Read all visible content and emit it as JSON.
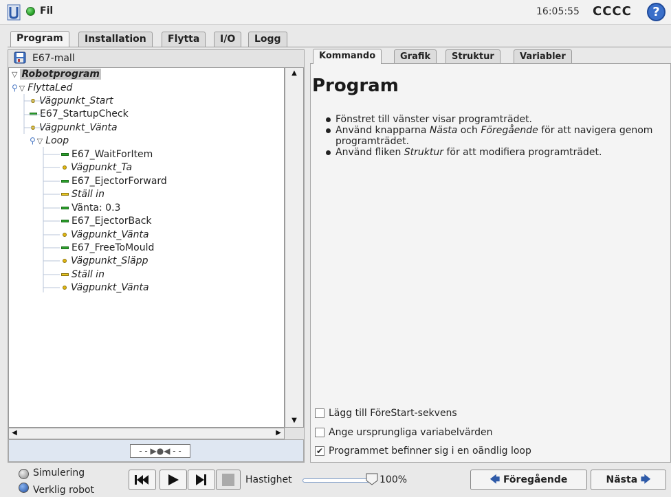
{
  "header": {
    "file_label": "Fil",
    "clock": "16:05:55",
    "robot_name": "CCCC",
    "help_glyph": "?"
  },
  "top_tabs": [
    {
      "label": "Program",
      "active": true
    },
    {
      "label": "Installation",
      "active": false
    },
    {
      "label": "Flytta",
      "active": false
    },
    {
      "label": "I/O",
      "active": false
    },
    {
      "label": "Logg",
      "active": false
    }
  ],
  "left": {
    "file_name": "E67-mall",
    "tree": [
      {
        "label": "Robotprogram",
        "type": "root",
        "style": "bold-italic-selected"
      },
      {
        "label": "FlyttaLed",
        "type": "folder",
        "style": "italic"
      },
      {
        "label": "Vägpunkt_Start",
        "type": "waypoint",
        "style": "italic"
      },
      {
        "label": "E67_StartupCheck",
        "type": "call",
        "style": "normal"
      },
      {
        "label": "Vägpunkt_Vänta",
        "type": "waypoint",
        "style": "italic"
      },
      {
        "label": "Loop",
        "type": "folder",
        "style": "italic"
      },
      {
        "label": "E67_WaitForItem",
        "type": "call",
        "style": "normal"
      },
      {
        "label": "Vägpunkt_Ta",
        "type": "waypoint",
        "style": "italic"
      },
      {
        "label": "E67_EjectorForward",
        "type": "call",
        "style": "normal"
      },
      {
        "label": "Ställ in",
        "type": "set",
        "style": "italic"
      },
      {
        "label": "Vänta: 0.3",
        "type": "call",
        "style": "normal"
      },
      {
        "label": "E67_EjectorBack",
        "type": "call",
        "style": "normal"
      },
      {
        "label": "Vägpunkt_Vänta",
        "type": "waypoint",
        "style": "italic"
      },
      {
        "label": "E67_FreeToMould",
        "type": "call",
        "style": "normal"
      },
      {
        "label": "Vägpunkt_Släpp",
        "type": "waypoint",
        "style": "italic"
      },
      {
        "label": "Ställ in",
        "type": "set",
        "style": "italic"
      },
      {
        "label": "Vägpunkt_Vänta",
        "type": "waypoint",
        "style": "italic"
      }
    ]
  },
  "right": {
    "tabs": [
      {
        "label": "Kommando",
        "active": true
      },
      {
        "label": "Grafik",
        "active": false
      },
      {
        "label": "Struktur",
        "active": false
      },
      {
        "label": "Variabler",
        "active": false
      }
    ],
    "title": "Program",
    "bullet1": "Fönstret till vänster visar programträdet.",
    "bullet2_pre": "Använd knapparna ",
    "bullet2_next": "Nästa",
    "bullet2_mid": " och ",
    "bullet2_prev": "Föregående",
    "bullet2_post": " för att navigera genom",
    "bullet2_line2": "programträdet.",
    "bullet3_pre": "Använd fliken ",
    "bullet3_struct": "Struktur",
    "bullet3_post": " för att modifiera programträdet.",
    "checkboxes": [
      {
        "label": "Lägg till FöreStart-sekvens",
        "checked": false
      },
      {
        "label": "Ange ursprungliga variabelvärden",
        "checked": false
      },
      {
        "label": "Programmet befinner sig i en oändlig loop",
        "checked": true
      }
    ]
  },
  "bottom": {
    "radio_sim": "Simulering",
    "radio_real": "Verklig robot",
    "speed_label": "Hastighet",
    "speed_value": "100%",
    "speed_fraction": 1.0,
    "prev_button": "Föregående",
    "next_button": "Nästa"
  }
}
